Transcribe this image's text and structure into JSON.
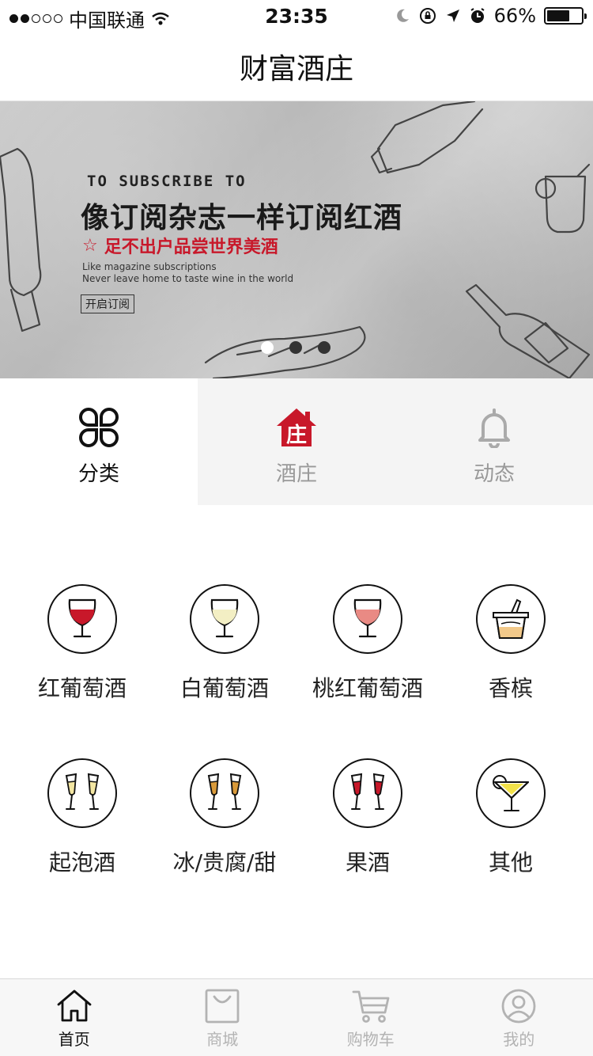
{
  "status_bar": {
    "carrier": "中国联通",
    "time": "23:35",
    "battery": "66%",
    "battery_level": 0.66
  },
  "header": {
    "title": "财富酒庄"
  },
  "banner": {
    "eyebrow": "TO SUBSCRIBE TO",
    "title": "像订阅杂志一样订阅红酒",
    "star": "☆",
    "subtitle": "足不出户品尝世界美酒",
    "en_line1": "Like magazine subscriptions",
    "en_line2": "Never leave home to taste wine in the world",
    "button": "开启订阅",
    "active_slide": 1,
    "slide_count": 3
  },
  "tabs": [
    {
      "label": "分类",
      "icon": "grid-icon",
      "active": true
    },
    {
      "label": "酒庄",
      "icon": "house-icon",
      "active": false,
      "badge_char": "庄"
    },
    {
      "label": "动态",
      "icon": "bell-icon",
      "active": false
    }
  ],
  "categories": [
    {
      "label": "红葡萄酒",
      "icon": "red-wine-glass-icon",
      "color": "#c8182a"
    },
    {
      "label": "白葡萄酒",
      "icon": "white-wine-glass-icon",
      "color": "#f3efc4"
    },
    {
      "label": "桃红葡萄酒",
      "icon": "rose-wine-glass-icon",
      "color": "#e98a84"
    },
    {
      "label": "香槟",
      "icon": "champagne-bucket-icon",
      "color": "#f2c98a"
    },
    {
      "label": "起泡酒",
      "icon": "sparkling-flutes-icon",
      "color": "#f3e6a2"
    },
    {
      "label": "冰/贵腐/甜",
      "icon": "dessert-wine-flutes-icon",
      "color": "#d99a3a"
    },
    {
      "label": "果酒",
      "icon": "fruit-wine-flutes-icon",
      "color": "#c8182a"
    },
    {
      "label": "其他",
      "icon": "cocktail-glass-icon",
      "color": "#f3e24a"
    }
  ],
  "tabbar": [
    {
      "label": "首页",
      "icon": "home-icon",
      "active": true
    },
    {
      "label": "商城",
      "icon": "shopping-bag-icon",
      "active": false
    },
    {
      "label": "购物车",
      "icon": "cart-icon",
      "active": false
    },
    {
      "label": "我的",
      "icon": "user-icon",
      "active": false
    }
  ]
}
